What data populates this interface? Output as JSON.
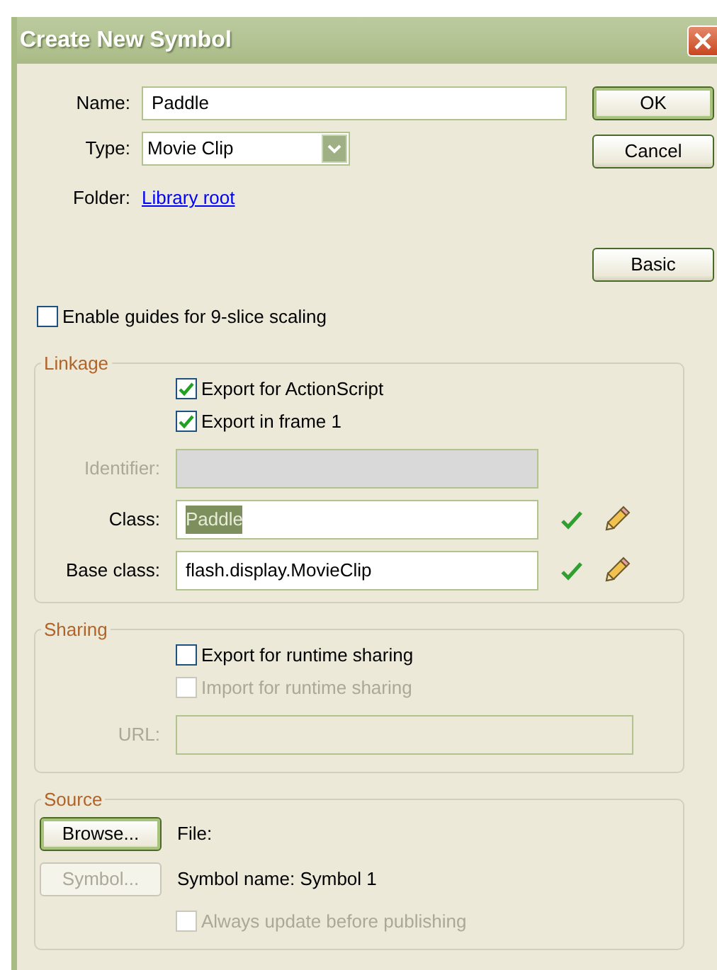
{
  "window": {
    "title": "Create New Symbol"
  },
  "name_field": {
    "label": "Name:",
    "value": "Paddle"
  },
  "type_field": {
    "label": "Type:",
    "value": "Movie Clip"
  },
  "folder": {
    "label": "Folder:",
    "link": "Library root"
  },
  "buttons": [
    {
      "label": "OK",
      "default": true
    },
    {
      "label": "Cancel",
      "default": false
    },
    {
      "label": "Basic",
      "default": false
    }
  ],
  "nine_slice": {
    "label": "Enable guides for 9-slice scaling",
    "checked": false,
    "disabled": false
  },
  "linkage": {
    "legend": "Linkage",
    "checkboxes": [
      {
        "label": "Export for ActionScript",
        "checked": true,
        "disabled": false
      },
      {
        "label": "Export in frame 1",
        "checked": true,
        "disabled": false
      }
    ],
    "fields": [
      {
        "label": "Identifier:",
        "disabled": true,
        "kind": "plain"
      },
      {
        "label": "Class:",
        "value": "Paddle",
        "text_selected": true,
        "disabled": false,
        "kind": "validated"
      },
      {
        "label": "Base class:",
        "value": "flash.display.MovieClip",
        "text_selected": false,
        "disabled": false,
        "kind": "validated"
      }
    ]
  },
  "sharing": {
    "legend": "Sharing",
    "checkboxes": [
      {
        "label": "Export for runtime sharing",
        "checked": false,
        "disabled": false
      },
      {
        "label": "Import for runtime sharing",
        "checked": false,
        "disabled": true
      }
    ],
    "fields": [
      {
        "label": "URL:",
        "disabled": true,
        "kind": "plain"
      }
    ]
  },
  "source": {
    "legend": "Source",
    "buttons": [
      {
        "label": "Browse...",
        "default": true,
        "disabled": false
      },
      {
        "label": "Symbol...",
        "default": false,
        "disabled": true
      }
    ],
    "file_label": "File:",
    "symbol_name": "Symbol name: Symbol 1",
    "checkbox": {
      "label": "Always update before publishing",
      "checked": false,
      "disabled": true
    }
  }
}
